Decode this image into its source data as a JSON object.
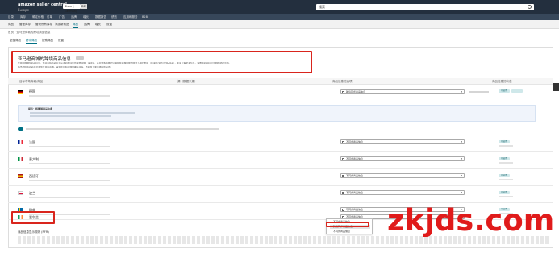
{
  "header": {
    "logo": "amazon seller central",
    "logo_sub": "Europe",
    "account": "Store | Germany",
    "account_tag": "DE",
    "search_placeholder": "搜索"
  },
  "nav": {
    "items": [
      "目录",
      "库存",
      "确定价格",
      "订单",
      "广告",
      "品牌",
      "增长",
      "数据报告",
      "绩效",
      "应用和服务",
      "B2B"
    ]
  },
  "menu": {
    "items": [
      "商品",
      "管理库存",
      "管理所有库存",
      "添加新商品",
      "商品",
      "品牌",
      "增长",
      "设置"
    ],
    "active_index": 4
  },
  "breadcrumb": "首页 / 亚马逊商城的跨境商品信息",
  "tabs": [
    "全部商品",
    "跨境商品",
    "搜索商品",
    "设置"
  ],
  "hero": {
    "title": "亚马逊商城的跨境商品信息",
    "desc1": "使用商城跨境商品信息，您可以将商品信息从源商城同步到其他商城。请注意，来自这些商城的订单将在商城目前的状态下进行处理（原语言/货币/尺码/商品），如需了解更多信息，请参阅商品信息页面的帮助页面。",
    "desc2": "将当地原有商品信息添加至目标商城，请先在目标商城中确认商品，然后在下面选择同步设置。"
  },
  "columns": {
    "target": "目标市场商城/商品",
    "source": "源（数据来源）",
    "method": "商品信息的选项",
    "status": "商品信息的状态"
  },
  "source_row": {
    "country": "德国",
    "select": "跨境同步商品信息",
    "status": "已启用"
  },
  "infobox": {
    "title": "提示：将德国商品信息"
  },
  "toggle_text": "将德国商品信息同步至所有选定商城",
  "rows": [
    {
      "country": "法国",
      "select": "不同步商品信息",
      "status": "已启用"
    },
    {
      "country": "意大利",
      "select": "不同步商品信息",
      "status": "已启用"
    },
    {
      "country": "西班牙",
      "select": "不同步商品信息",
      "status": "已启用"
    },
    {
      "country": "波兰",
      "select": "不同步商品信息",
      "status": "已启用"
    },
    {
      "country": "瑞典",
      "select": "不同步商品信息",
      "status": "已启用"
    },
    {
      "country": "爱尔兰",
      "select": "不同步商品信息",
      "status": "已启用"
    }
  ],
  "dropdown": {
    "options": [
      "不同步商品信息",
      "跨境同步商品信息",
      "不同步商品信息"
    ]
  },
  "bottom_text": "商品信息显示规则 (RFR)",
  "watermark": "zkjds.com",
  "colors": {
    "header": "#232f3e",
    "accent": "#007185",
    "highlight": "#d9251d",
    "watermark": "#e01b1b"
  }
}
